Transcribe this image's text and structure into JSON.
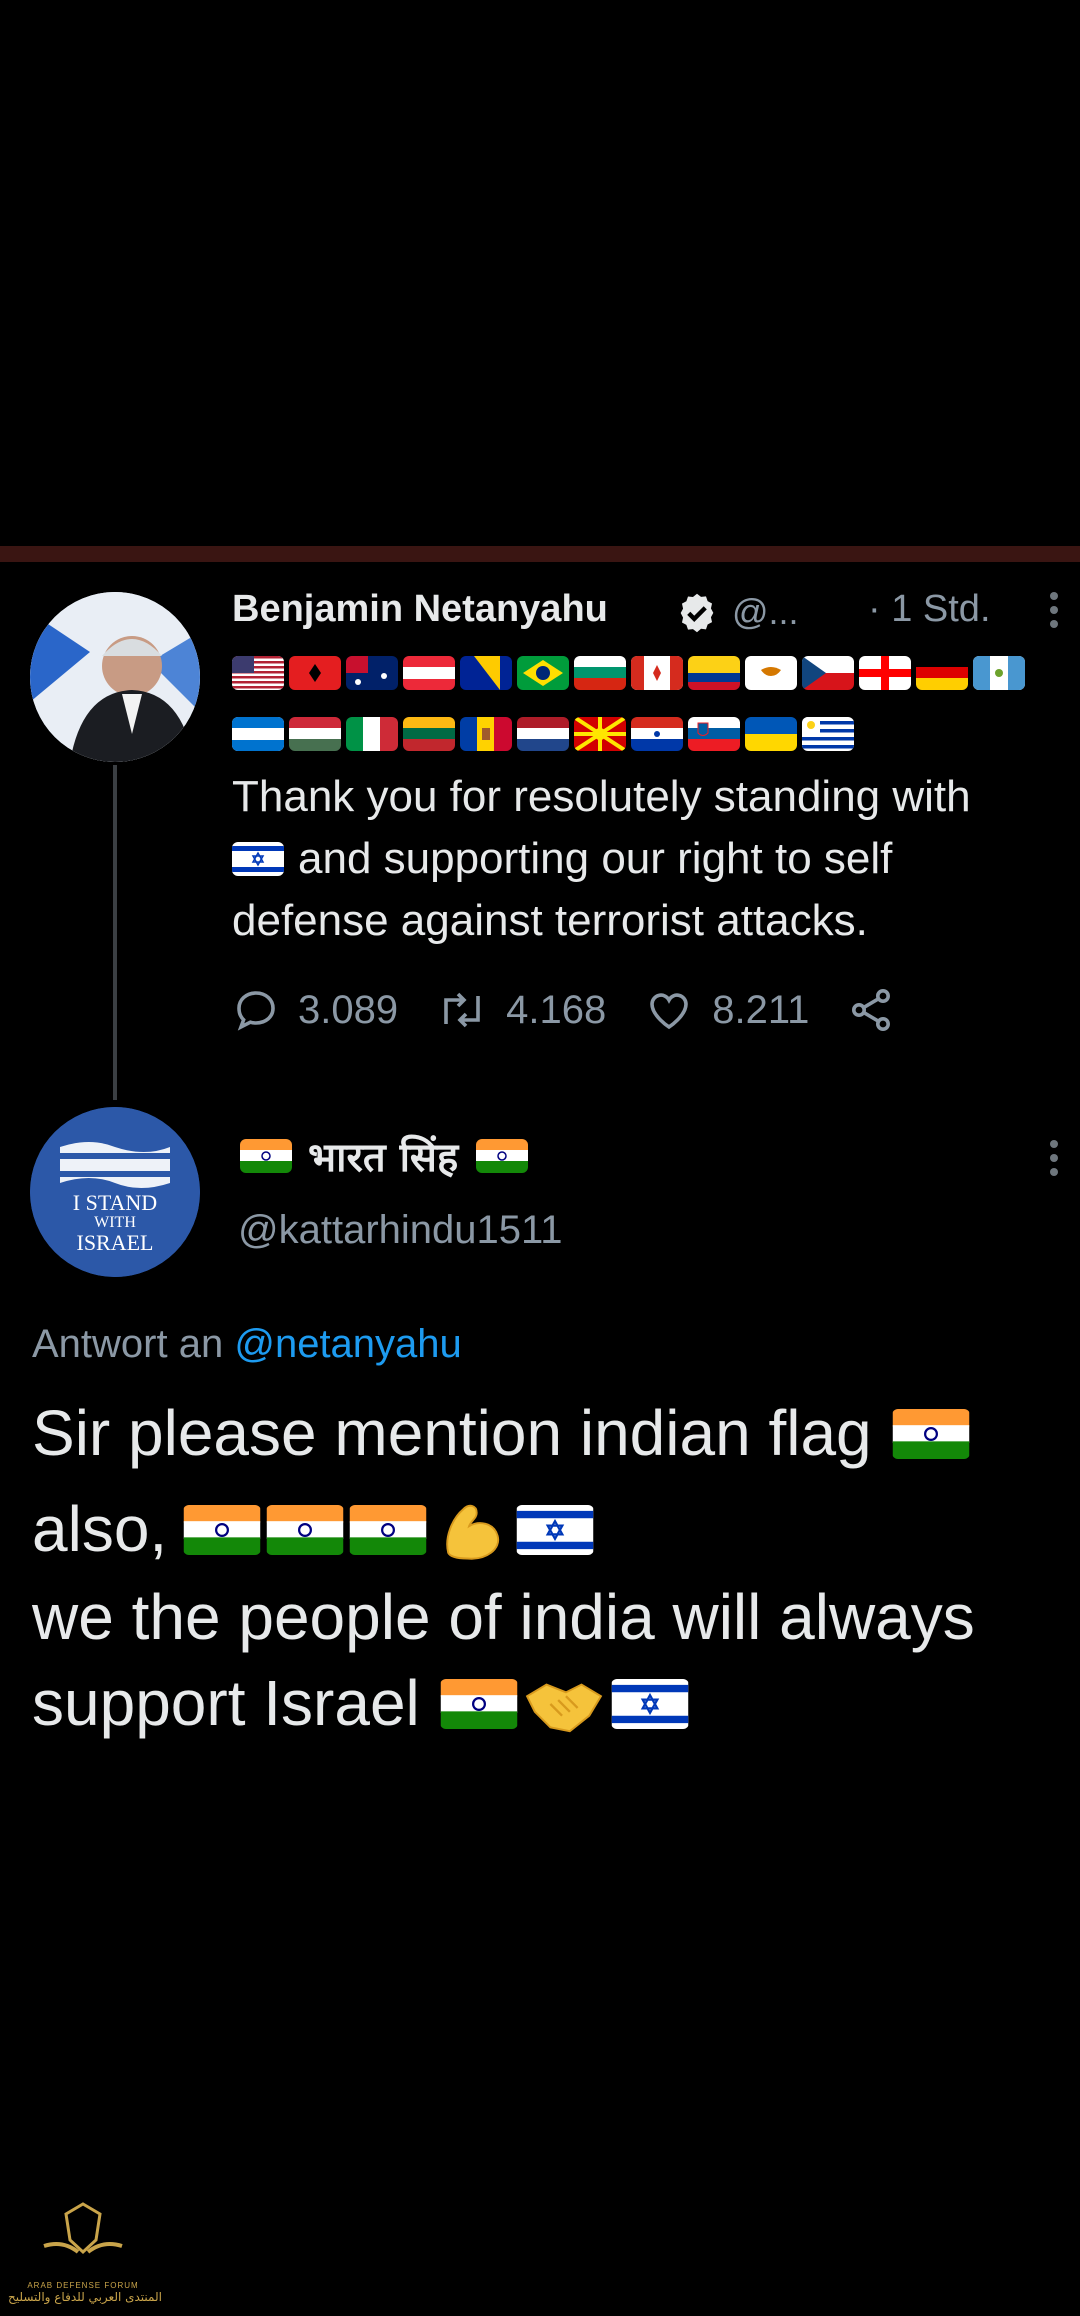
{
  "tweet": {
    "author_name": "Benjamin Netanyahu",
    "handle_truncated": "@...",
    "time": "· 1 Std.",
    "flags_row1": [
      "us",
      "al",
      "au",
      "at",
      "ba",
      "br",
      "bg",
      "ca",
      "co",
      "cy",
      "cz",
      "ge",
      "de",
      "gt"
    ],
    "flags_row2": [
      "hn",
      "hu",
      "it",
      "lt",
      "md",
      "nl",
      "mk",
      "py",
      "si",
      "ua",
      "uy"
    ],
    "text_line1": "Thank you for resolutely standing with",
    "text_line2": "and supporting our right to self",
    "text_line3": "defense against terrorist attacks.",
    "reply_count": "3.089",
    "retweet_count": "4.168",
    "like_count": "8.211"
  },
  "reply": {
    "author_name": "भारत सिंह",
    "handle": "@kattarhindu1511",
    "avatar_text": [
      "I STAND",
      "WITH",
      "ISRAEL"
    ],
    "reply_to_prefix": "Antwort an",
    "reply_to_handle": "@netanyahu",
    "line1": "Sir please mention indian flag",
    "line2": "also,",
    "line3": "we the people of india will always",
    "line4": "support Israel"
  },
  "watermark": {
    "line1": "ARAB DEFENSE FORUM",
    "line2": "المنتدى العربي للدفاع والتسليح"
  },
  "colors": {
    "background": "#000000",
    "text": "#e7e9ea",
    "muted": "#8b98a5",
    "link": "#1d9bf0",
    "verified": "#ffffff"
  }
}
